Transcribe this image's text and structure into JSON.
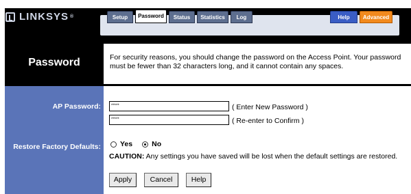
{
  "brand": {
    "name": "LINKSYS",
    "reg": "®"
  },
  "tabs": [
    {
      "label": "Setup"
    },
    {
      "label": "Password"
    },
    {
      "label": "Status"
    },
    {
      "label": "Statistics"
    },
    {
      "label": "Log"
    },
    {
      "label": "Help"
    },
    {
      "label": "Advanced"
    }
  ],
  "section_title": "Password",
  "description": "For security reasons, you should change the password on the Access Point. Your password must be fewer than 32 characters long, and it cannot contain any spaces.",
  "ap_password": {
    "label": "AP Password:",
    "new_value": "*****",
    "new_hint": "( Enter New Password )",
    "confirm_value": "*****",
    "confirm_hint": "( Re-enter to Confirm )"
  },
  "restore": {
    "label": "Restore Factory Defaults:",
    "yes": "Yes",
    "no": "No",
    "selected": "No",
    "caution_label": "CAUTION:",
    "caution_text": " Any settings you have saved will be lost when the default settings are restored."
  },
  "buttons": {
    "apply": "Apply",
    "cancel": "Cancel",
    "help": "Help"
  },
  "colors": {
    "sidebar": "#5a74b8",
    "header": "#000000",
    "tab": "#5d6e8f",
    "help_tab": "#3a5dc5",
    "advanced_tab": "#f28a1e"
  }
}
